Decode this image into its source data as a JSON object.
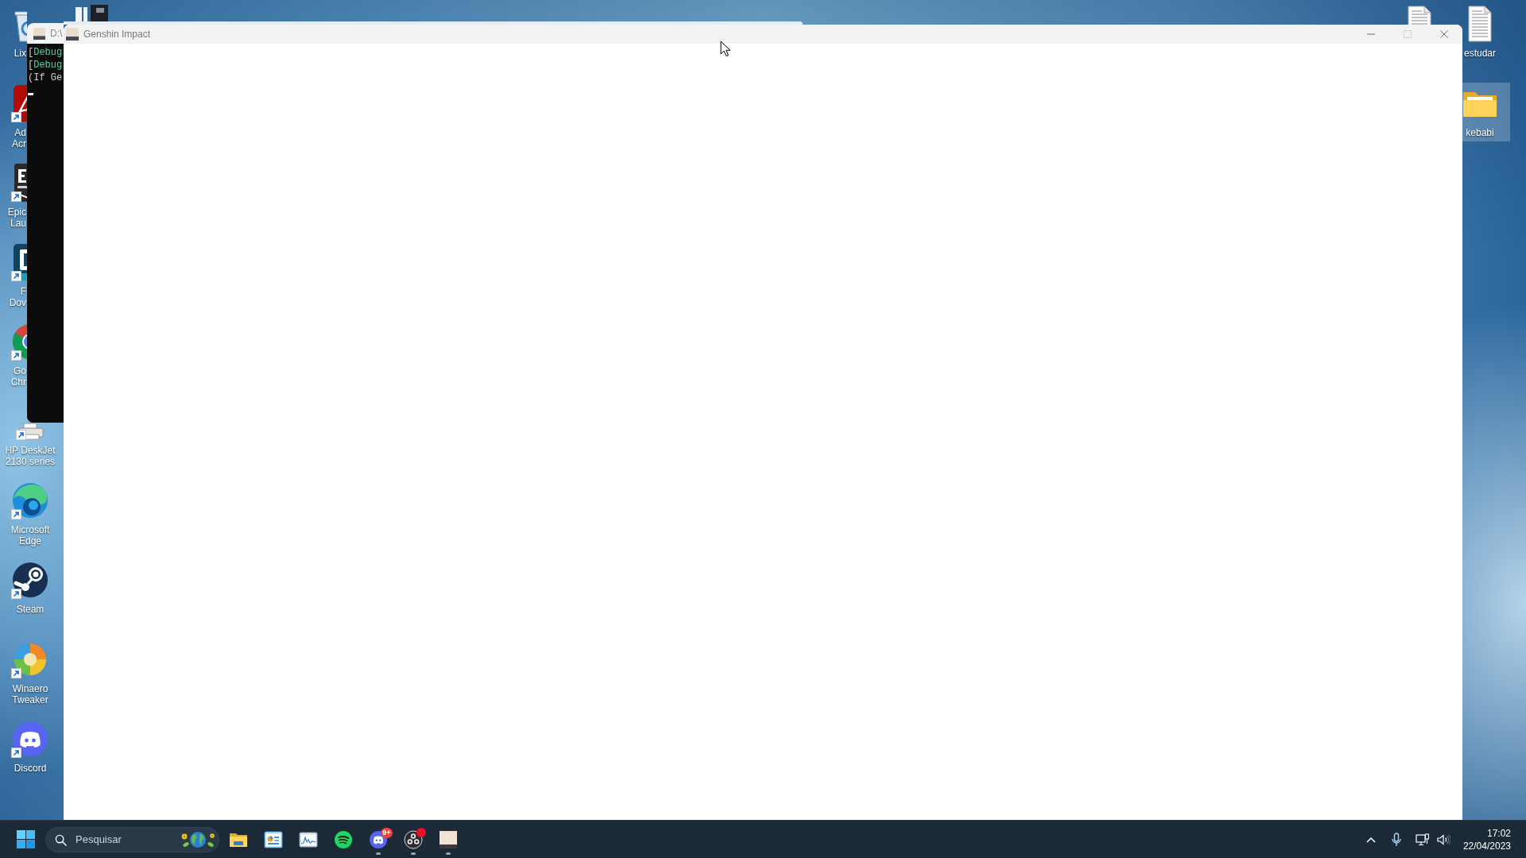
{
  "desktop": {
    "icons_left": [
      {
        "kind": "recycle-bin",
        "label_lines": [
          "Lix"
        ],
        "selected": false
      },
      {
        "kind": "pdf-app",
        "label_lines": [
          "Ad",
          "Acr"
        ],
        "selected": false
      },
      {
        "kind": "game-store",
        "label_lines": [
          "Epic",
          "Lau"
        ],
        "selected": false
      },
      {
        "kind": "downloader",
        "label_lines": [
          "F",
          "Dov"
        ],
        "selected": false
      },
      {
        "kind": "chrome-browser",
        "label_lines": [
          "Go",
          "Chr"
        ],
        "selected": false
      },
      {
        "kind": "printer",
        "label_lines": [
          "HP DeskJet",
          "2130 series"
        ],
        "selected": false
      },
      {
        "kind": "edge-browser",
        "label_lines": [
          "Microsoft",
          "Edge"
        ],
        "selected": false
      },
      {
        "kind": "game-launcher",
        "label_lines": [
          "Steam"
        ],
        "selected": false
      },
      {
        "kind": "tweaker",
        "label_lines": [
          "Winaero",
          "Tweaker"
        ],
        "selected": false
      },
      {
        "kind": "chat-app",
        "label_lines": [
          "Discord"
        ],
        "selected": false
      }
    ],
    "icons_left_2": [
      {
        "kind": "app-tile",
        "selected": false
      }
    ],
    "icons_right_2": [
      {
        "kind": "text-file",
        "selected": false
      }
    ],
    "icons_right": [
      {
        "kind": "text-file",
        "label_lines": [
          "estudar"
        ],
        "selected": false
      },
      {
        "kind": "folder",
        "label_lines": [
          "kebabi"
        ],
        "selected": true
      }
    ]
  },
  "terminal_window": {
    "title": "D:\\",
    "lines": [
      {
        "segments": [
          {
            "kind": "plain",
            "text": "["
          },
          {
            "kind": "tag",
            "text": "Debug"
          }
        ]
      },
      {
        "segments": [
          {
            "kind": "plain",
            "text": "["
          },
          {
            "kind": "tag",
            "text": "Debug"
          }
        ]
      },
      {
        "segments": [
          {
            "kind": "plain",
            "text": "(If Ge"
          }
        ]
      }
    ]
  },
  "game_window": {
    "title": "Genshin Impact",
    "controls": [
      {
        "kind": "minimize",
        "disabled": false
      },
      {
        "kind": "maximize",
        "disabled": true
      },
      {
        "kind": "close",
        "disabled": false
      }
    ]
  },
  "taskbar": {
    "search": {
      "placeholder": "Pesquisar"
    },
    "apps": [
      {
        "kind": "file-explorer",
        "running": false,
        "alert": false
      },
      {
        "kind": "chart-window",
        "running": false,
        "alert": false
      },
      {
        "kind": "graph-window",
        "running": false,
        "alert": false
      },
      {
        "kind": "music",
        "running": false,
        "alert": false
      },
      {
        "kind": "chat",
        "running": true,
        "alert": false,
        "badge": "9+"
      },
      {
        "kind": "recorder",
        "running": true,
        "alert": true
      },
      {
        "kind": "game",
        "running": true,
        "alert": false
      }
    ],
    "clock": {
      "time": "17:02",
      "date": "22/04/2023"
    }
  }
}
